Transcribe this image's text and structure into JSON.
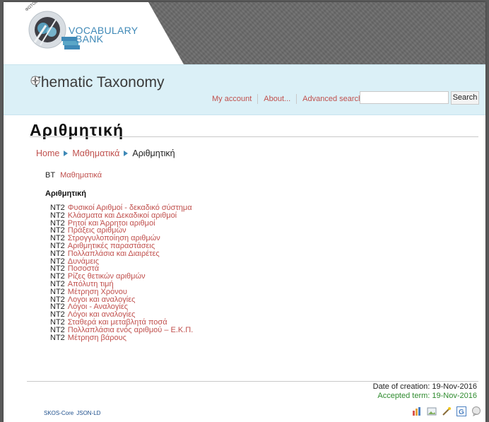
{
  "logo": {
    "arc_text": "ΦΩΤΟΔΕΝΤΡΟ",
    "line1": "VOCABULARY",
    "line2": "BANK"
  },
  "header": {
    "title": "Thematic Taxonomy"
  },
  "nav": {
    "my_account": "My account",
    "about": "About...",
    "advanced_search": "Advanced search",
    "search_value": "",
    "search_button": "Search"
  },
  "page": {
    "heading": "Αριθμητική",
    "breadcrumb": {
      "home": "Home",
      "parent": "Μαθηματικά",
      "current": "Αριθμητική"
    },
    "bt": {
      "tag": "BT",
      "term": "Μαθηματικά"
    },
    "concept": "Αριθμητική",
    "nt_tag": "NT2",
    "narrower": [
      "Φυσικοί Αριθμοί - δεκαδικό σύστημα",
      "Κλάσματα και Δεκαδικοί αριθμοί",
      "Ρητοί και Άρρητοι αριθμοί",
      "Πράξεις αριθμών",
      "Στρογγυλοποίηση αριθμών",
      "Αριθμητικές παραστάσεις",
      "Πολλαπλάσια και Διαιρέτες",
      "Δυνάμεις",
      "Ποσοστά",
      "Ρίζες θετικών αριθμών",
      "Απόλυτη τιμή",
      "Μέτρηση Χρόνου",
      "Λογοι και αναλογίες",
      "Λόγοι - Αναλογίες",
      "Λόγοι και αναλογίες",
      "Σταθερά και μεταβλητά ποσά",
      "Πολλαπλάσια ενός αριθμού – Ε.Κ.Π.",
      "Μέτρηση βάρους"
    ]
  },
  "footer": {
    "date_created": "Date of creation: 19-Nov-2016",
    "date_accepted": "Accepted term: 19-Nov-2016",
    "formats": [
      "SKOS-Core",
      "JSON-LD"
    ],
    "icons": [
      "chart-icon",
      "image-icon",
      "magic-wand-icon",
      "google-icon",
      "speech-bubble-icon"
    ]
  },
  "colors": {
    "link": "#c0504d",
    "accent": "#3f89b7",
    "band": "#dbf0f7",
    "accepted": "#2e8b2e"
  }
}
